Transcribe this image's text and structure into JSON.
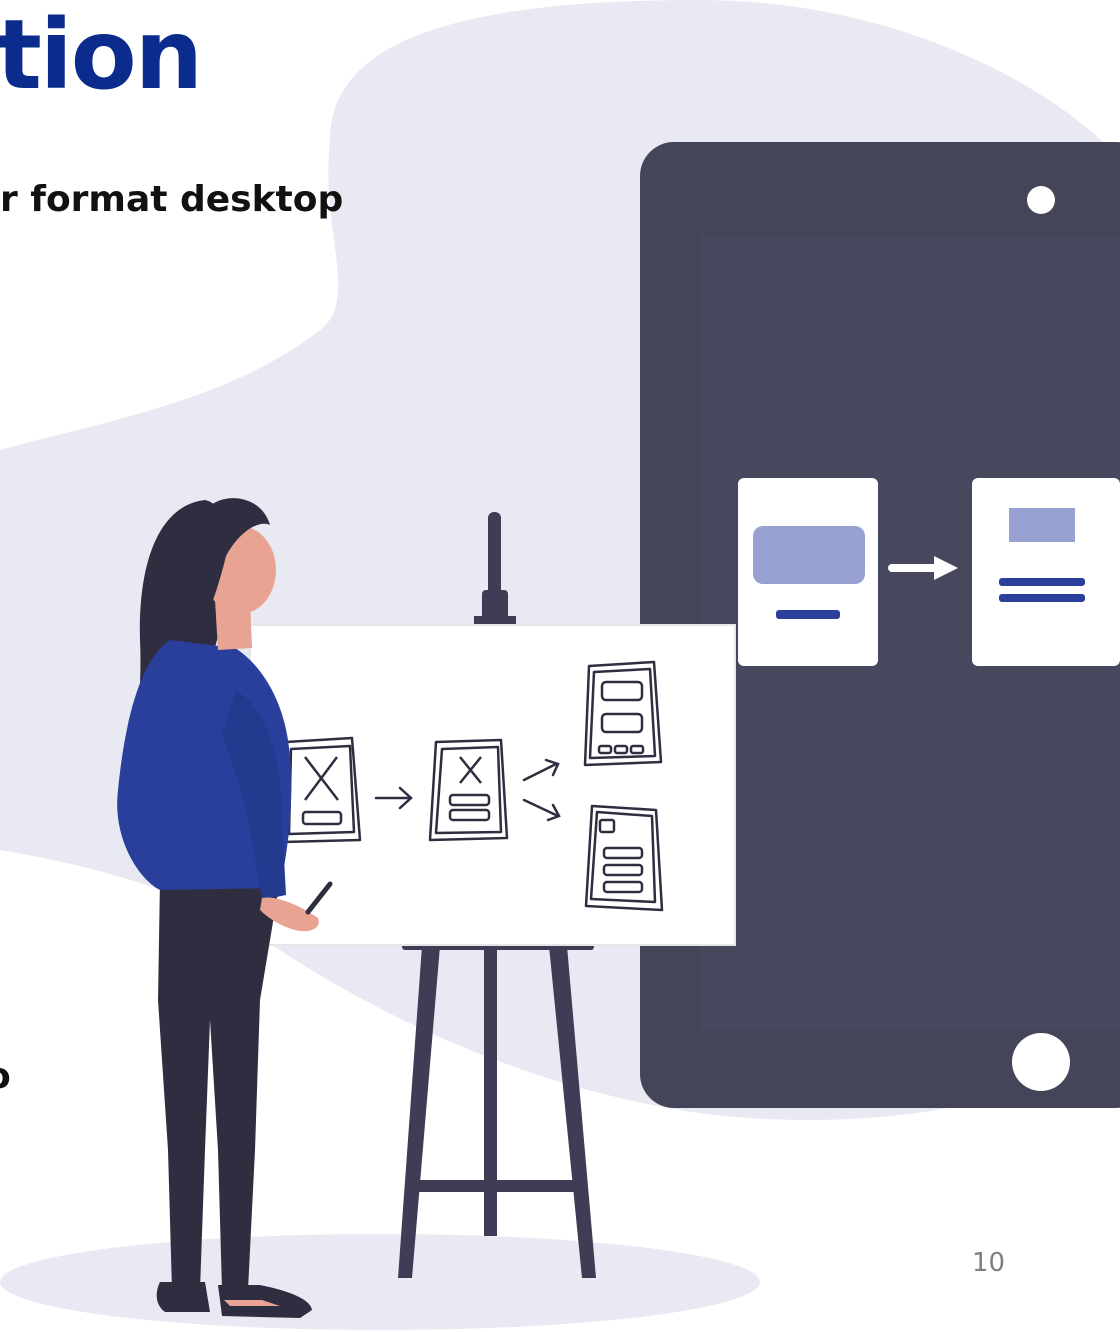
{
  "slide": {
    "title": "tion",
    "subtitle": "r format desktop",
    "edge_glyph": "o",
    "page_number": "10"
  },
  "colors": {
    "title": "#0b2c8c",
    "blob": "#e8e9f3",
    "device": "#45455a",
    "accent_blue": "#2a3f9c",
    "card_fill": "#97a2d2",
    "figure_dark": "#2f2e41",
    "skin": "#e8a393"
  },
  "icons": {
    "device_camera": "circle-icon",
    "device_home_button": "circle-icon",
    "flow_arrow": "arrow-right-icon",
    "wireframe_cross": "x-icon"
  }
}
